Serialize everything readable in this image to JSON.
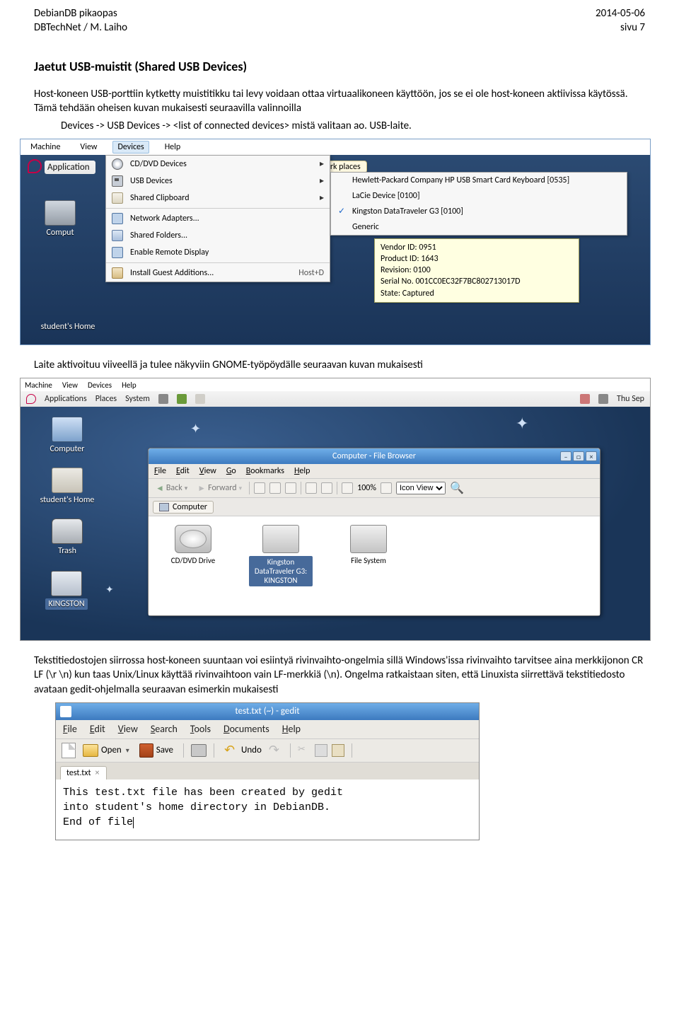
{
  "header": {
    "left_line1": "DebianDB pikaopas",
    "left_line2": "DBTechNet / M. Laiho",
    "right_line1": "2014-05-06",
    "right_line2": "sivu 7"
  },
  "section1": {
    "title": "Jaetut USB-muistit (Shared USB Devices)",
    "para1": "Host-koneen USB-porttiin kytketty muistitikku tai levy voidaan ottaa virtuaalikoneen käyttöön, jos se ei ole host-koneen aktiivissa käytössä. Tämä tehdään oheisen kuvan mukaisesti seuraavilla valinnoilla",
    "para2": "Devices -> USB Devices -> <list of connected devices> mistä valitaan ao. USB-laite."
  },
  "shot1": {
    "menubar": [
      "Machine",
      "View",
      "Devices",
      "Help"
    ],
    "applications": "Application",
    "desk_computer": "Comput",
    "desk_home": "student's Home",
    "float_label": "twork places",
    "menu_items": [
      {
        "icon": "disc",
        "label": "CD/DVD Devices",
        "sub": true
      },
      {
        "icon": "usb",
        "label": "USB Devices",
        "sub": true
      },
      {
        "icon": "clip",
        "label": "Shared Clipboard",
        "sub": true
      },
      {
        "icon": "net",
        "label": "Network Adapters..."
      },
      {
        "icon": "folder",
        "label": "Shared Folders..."
      },
      {
        "icon": "display",
        "label": "Enable Remote Display"
      },
      {
        "icon": "pkg",
        "label": "Install Guest Additions...",
        "hotkey": "Host+D"
      }
    ],
    "submenu": [
      {
        "checked": false,
        "label": "Hewlett-Packard Company HP USB Smart Card Keyboard [0535]"
      },
      {
        "checked": false,
        "label": "LaCie Device [0100]"
      },
      {
        "checked": true,
        "label": "Kingston DataTraveler G3 [0100]"
      },
      {
        "checked": false,
        "label": "Generic"
      }
    ],
    "tooltip": {
      "l1": "Vendor ID: 0951",
      "l2": "Product ID: 1643",
      "l3": "Revision: 0100",
      "l4": "Serial No. 001CC0EC32F7BC802713017D",
      "l5": "State: Captured"
    }
  },
  "mid_caption": "Laite aktivoituu viiveellä ja tulee näkyviin GNOME-työpöydälle seuraavan kuvan mukaisesti",
  "shot2": {
    "menubar": [
      "Machine",
      "View",
      "Devices",
      "Help"
    ],
    "panel": {
      "items": [
        "Applications",
        "Places",
        "System"
      ],
      "right": "Thu Sep"
    },
    "desk": {
      "computer": "Computer",
      "home": "student's Home",
      "trash": "Trash",
      "kingston": "KINGSTON"
    },
    "filewin": {
      "title": "Computer - File Browser",
      "menu": [
        "File",
        "Edit",
        "View",
        "Go",
        "Bookmarks",
        "Help"
      ],
      "toolbar": {
        "back": "Back",
        "forward": "Forward",
        "zoom": "100%",
        "view": "Icon View"
      },
      "location": "Computer",
      "items": [
        {
          "type": "cd",
          "label": "CD/DVD Drive"
        },
        {
          "type": "drive",
          "label": "Kingston DataTraveler G3: KINGSTON",
          "selected": true
        },
        {
          "type": "drive",
          "label": "File System"
        }
      ]
    }
  },
  "section3": {
    "para": "Tekstitiedostojen siirrossa host-koneen suuntaan voi esiintyä rivinvaihto-ongelmia sillä Windows'issa rivinvaihto tarvitsee aina merkkijonon CR LF (\\r \\n) kun taas Unix/Linux käyttää rivinvaihtoon vain LF-merkkiä (\\n). Ongelma ratkaistaan siten, että Linuxista siirrettävä tekstitiedosto avataan gedit-ohjelmalla seuraavan esimerkin mukaisesti"
  },
  "shot3": {
    "title": "test.txt (~) - gedit",
    "menu": [
      "File",
      "Edit",
      "View",
      "Search",
      "Tools",
      "Documents",
      "Help"
    ],
    "toolbar": {
      "open": "Open",
      "save": "Save",
      "undo": "Undo"
    },
    "tab": "test.txt",
    "line1": "This test.txt file has been created by gedit",
    "line2": "into student's home directory in DebianDB.",
    "line3": "End of file"
  }
}
